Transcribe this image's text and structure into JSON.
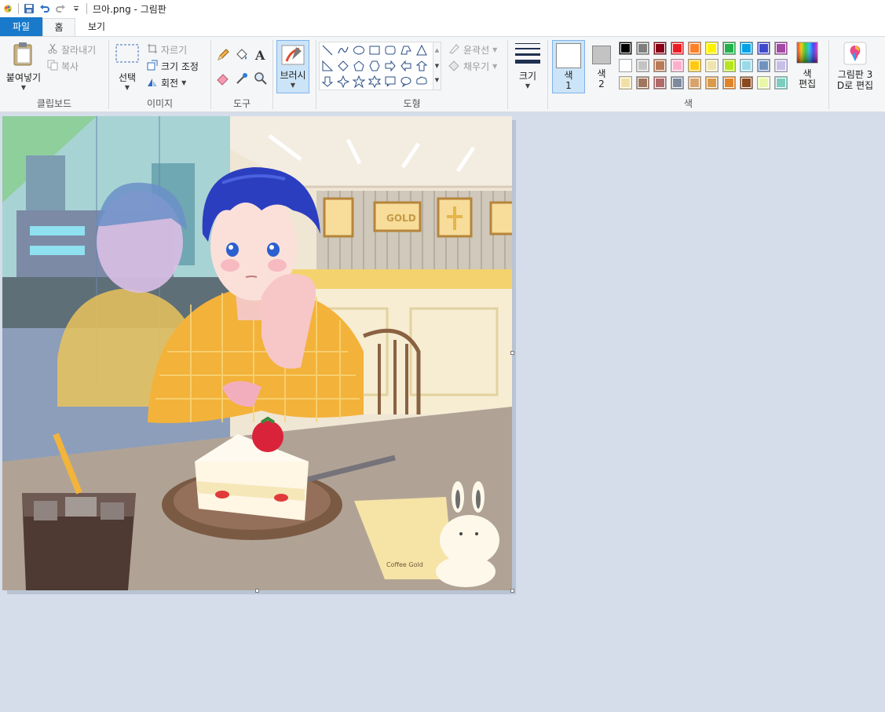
{
  "window": {
    "title": "므아.png - 그림판"
  },
  "tabs": {
    "file": "파일",
    "home": "홈",
    "view": "보기"
  },
  "clipboard": {
    "paste": "붙여넣기",
    "cut": "잘라내기",
    "copy": "복사",
    "label": "클립보드"
  },
  "image": {
    "select": "선택",
    "crop": "자르기",
    "resize": "크기 조정",
    "rotate": "회전",
    "label": "이미지"
  },
  "tools": {
    "label": "도구"
  },
  "brushes": {
    "label": "브러시"
  },
  "shapes": {
    "outline": "윤곽선",
    "fill": "채우기",
    "label": "도형"
  },
  "size": {
    "label": "크기"
  },
  "colors": {
    "color1": "색\n1",
    "color1_a": "색",
    "color1_b": "1",
    "color2_a": "색",
    "color2_b": "2",
    "edit_a": "색",
    "edit_b": "편집",
    "label": "색",
    "palette": [
      "#000000",
      "#7f7f7f",
      "#880015",
      "#ed1c24",
      "#ff7f27",
      "#fff200",
      "#22b14c",
      "#00a2e8",
      "#3f48cc",
      "#a349a4",
      "#ffffff",
      "#c3c3c3",
      "#b97a57",
      "#ffaec9",
      "#ffc90e",
      "#efe4b0",
      "#b5e61d",
      "#99d9ea",
      "#7092be",
      "#c8bfe7",
      "#f0e0a8",
      "#a0765c",
      "#b06a6a",
      "#7d8a9c",
      "#d8a26c",
      "#d89a4c",
      "#e0842a",
      "#8a4a1c",
      "#e8f7a8",
      "#7ccdbf"
    ]
  },
  "paint3d": {
    "line1": "그림판 3",
    "line2": "D로 편집"
  },
  "artwork": {
    "sign_text": "GOLD",
    "napkin_text": "Coffee Gold"
  }
}
